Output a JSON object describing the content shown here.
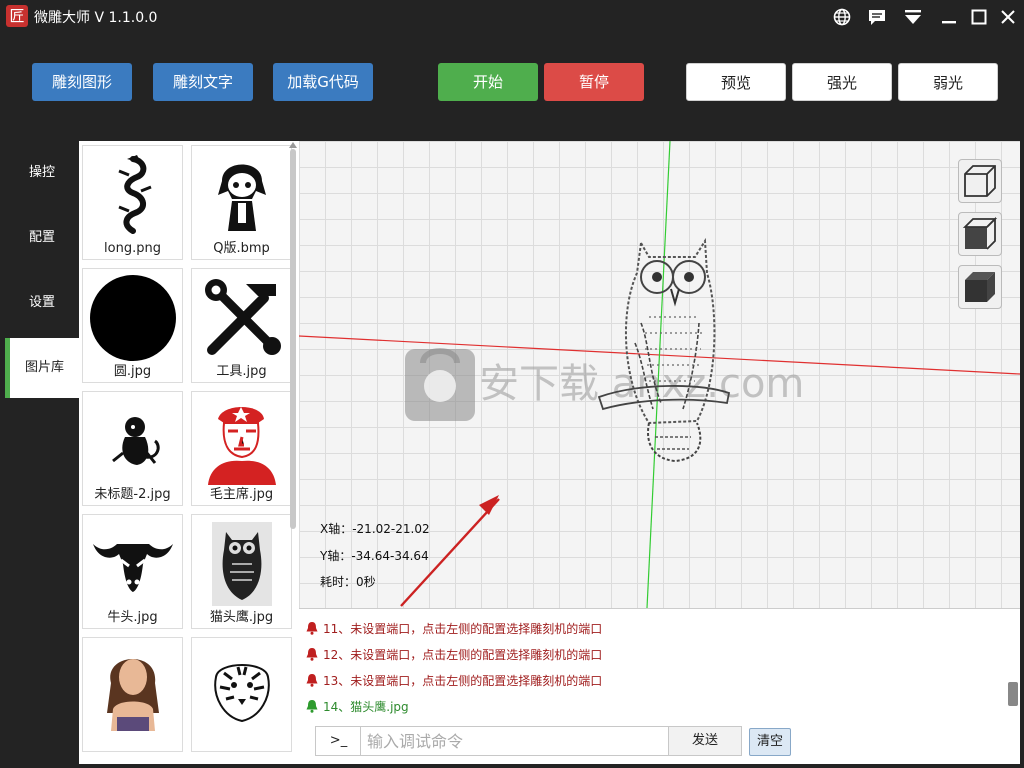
{
  "app": {
    "title": "微雕大师 V 1.1.0.0",
    "logo_char": "匠"
  },
  "titlebar": {
    "icons": [
      "globe-icon",
      "message-icon",
      "dropdown-menu-icon",
      "minimize-icon",
      "maximize-icon",
      "close-icon"
    ]
  },
  "toolbar": {
    "engrave_shape": "雕刻图形",
    "engrave_text": "雕刻文字",
    "load_gcode": "加载G代码",
    "start": "开始",
    "pause": "暂停",
    "preview": "预览",
    "strong_light": "强光",
    "weak_light": "弱光"
  },
  "nav": {
    "items": [
      {
        "label": "操控"
      },
      {
        "label": "配置"
      },
      {
        "label": "设置"
      },
      {
        "label": "图片库",
        "active": true
      }
    ]
  },
  "gallery": {
    "items": [
      {
        "label": "long.png",
        "icon": "dragon-image"
      },
      {
        "label": "Q版.bmp",
        "icon": "chibi-image"
      },
      {
        "label": "圆.jpg",
        "icon": "circle-image"
      },
      {
        "label": "工具.jpg",
        "icon": "tools-image"
      },
      {
        "label": "未标题-2.jpg",
        "icon": "monkey-image"
      },
      {
        "label": "毛主席.jpg",
        "icon": "portrait-image"
      },
      {
        "label": "牛头.jpg",
        "icon": "bull-head-image"
      },
      {
        "label": "猫头鹰.jpg",
        "icon": "owl-image"
      },
      {
        "label": "",
        "icon": "woman-photo-image"
      },
      {
        "label": "",
        "icon": "tiger-image"
      }
    ]
  },
  "canvas": {
    "readouts": {
      "x_axis": "X轴：-21.02-21.02",
      "y_axis": "Y轴：-34.64-34.64",
      "elapsed": "耗时：0秒"
    },
    "view_buttons": [
      "wireframe-cube-icon",
      "shaded-cube-icon",
      "solid-cube-icon"
    ],
    "watermark": "安下载 anxz.com"
  },
  "log": {
    "lines": [
      {
        "text": "11、未设置端口，点击左侧的配置选择雕刻机的端口",
        "status": "error"
      },
      {
        "text": "12、未设置端口，点击左侧的配置选择雕刻机的端口",
        "status": "error"
      },
      {
        "text": "13、未设置端口，点击左侧的配置选择雕刻机的端口",
        "status": "error"
      },
      {
        "text": "14、猫头鹰.jpg",
        "status": "ok"
      }
    ]
  },
  "command": {
    "prompt": ">_",
    "placeholder": "输入调试命令",
    "value": "",
    "send": "发送",
    "clear": "清空"
  },
  "colors": {
    "background": "#232323",
    "primary_blue": "#3b7bc0",
    "start_green": "#4fae4d",
    "pause_red": "#dc4b47",
    "error_text": "#a01e1e",
    "ok_text": "#2e8b2e"
  }
}
